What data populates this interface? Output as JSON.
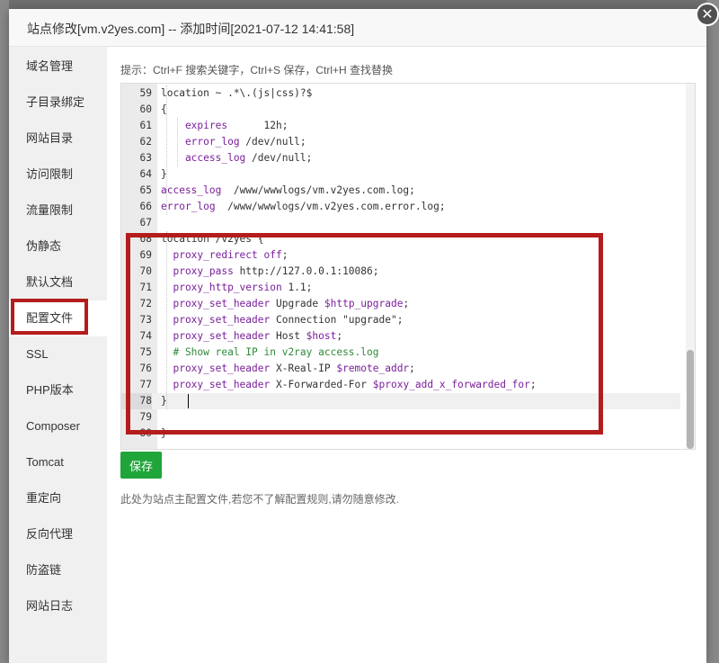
{
  "modal": {
    "title": "站点修改[vm.v2yes.com] -- 添加时间[2021-07-12 14:41:58]",
    "close_glyph": "✕"
  },
  "sidebar": {
    "items": [
      {
        "label": "域名管理"
      },
      {
        "label": "子目录绑定"
      },
      {
        "label": "网站目录"
      },
      {
        "label": "访问限制"
      },
      {
        "label": "流量限制"
      },
      {
        "label": "伪静态"
      },
      {
        "label": "默认文档"
      },
      {
        "label": "配置文件",
        "active": true
      },
      {
        "label": "SSL"
      },
      {
        "label": "PHP版本"
      },
      {
        "label": "Composer"
      },
      {
        "label": "Tomcat"
      },
      {
        "label": "重定向"
      },
      {
        "label": "反向代理"
      },
      {
        "label": "防盗链"
      },
      {
        "label": "网站日志"
      }
    ]
  },
  "editor": {
    "hint": "提示：Ctrl+F 搜索关键字，Ctrl+S 保存，Ctrl+H 查找替换",
    "current_line": 78,
    "lines": [
      {
        "n": "59",
        "segs": [
          [
            "pl",
            "location ~ .*\\.(js|css)?$"
          ]
        ]
      },
      {
        "n": "60",
        "segs": [
          [
            "pl",
            "{"
          ]
        ]
      },
      {
        "n": "61",
        "segs": [
          [
            "kw",
            "    expires"
          ],
          [
            "pl",
            "      12h;"
          ]
        ]
      },
      {
        "n": "62",
        "segs": [
          [
            "kw",
            "    error_log"
          ],
          [
            "pl",
            " /dev/null;"
          ]
        ]
      },
      {
        "n": "63",
        "segs": [
          [
            "kw",
            "    access_log"
          ],
          [
            "pl",
            " /dev/null;"
          ]
        ]
      },
      {
        "n": "64",
        "segs": [
          [
            "pl",
            "}"
          ]
        ]
      },
      {
        "n": "65",
        "segs": [
          [
            "kw",
            "access_log"
          ],
          [
            "pl",
            "  /www/wwwlogs/vm.v2yes.com.log;"
          ]
        ]
      },
      {
        "n": "66",
        "segs": [
          [
            "kw",
            "error_log"
          ],
          [
            "pl",
            "  /www/wwwlogs/vm.v2yes.com.error.log;"
          ]
        ]
      },
      {
        "n": "67",
        "segs": [
          [
            "pl",
            ""
          ]
        ]
      },
      {
        "n": "68",
        "segs": [
          [
            "pl",
            "location /v2yes {"
          ]
        ]
      },
      {
        "n": "69",
        "segs": [
          [
            "kw",
            "  proxy_redirect"
          ],
          [
            "vr",
            " off"
          ],
          [
            "pl",
            ";"
          ]
        ]
      },
      {
        "n": "70",
        "segs": [
          [
            "kw",
            "  proxy_pass"
          ],
          [
            "pl",
            " http://127.0.0.1:10086;"
          ]
        ]
      },
      {
        "n": "71",
        "segs": [
          [
            "kw",
            "  proxy_http_version"
          ],
          [
            "pl",
            " 1.1;"
          ]
        ]
      },
      {
        "n": "72",
        "segs": [
          [
            "kw",
            "  proxy_set_header"
          ],
          [
            "pl",
            " Upgrade "
          ],
          [
            "vr",
            "$http_upgrade"
          ],
          [
            "pl",
            ";"
          ]
        ]
      },
      {
        "n": "73",
        "segs": [
          [
            "kw",
            "  proxy_set_header"
          ],
          [
            "pl",
            " Connection \"upgrade\";"
          ]
        ]
      },
      {
        "n": "74",
        "segs": [
          [
            "kw",
            "  proxy_set_header"
          ],
          [
            "pl",
            " Host "
          ],
          [
            "vr",
            "$host"
          ],
          [
            "pl",
            ";"
          ]
        ]
      },
      {
        "n": "75",
        "segs": [
          [
            "cm",
            "  # Show real IP in v2ray access.log"
          ]
        ]
      },
      {
        "n": "76",
        "segs": [
          [
            "kw",
            "  proxy_set_header"
          ],
          [
            "pl",
            " X-Real-IP "
          ],
          [
            "vr",
            "$remote_addr"
          ],
          [
            "pl",
            ";"
          ]
        ]
      },
      {
        "n": "77",
        "segs": [
          [
            "kw",
            "  proxy_set_header"
          ],
          [
            "pl",
            " X-Forwarded-For "
          ],
          [
            "vr",
            "$proxy_add_x_forwarded_for"
          ],
          [
            "pl",
            ";"
          ]
        ]
      },
      {
        "n": "78",
        "segs": [
          [
            "pl",
            "}"
          ]
        ]
      },
      {
        "n": "79",
        "segs": [
          [
            "pl",
            ""
          ]
        ]
      },
      {
        "n": "80",
        "segs": [
          [
            "pl",
            "}"
          ]
        ]
      }
    ]
  },
  "actions": {
    "save_label": "保存",
    "note": "此处为站点主配置文件,若您不了解配置规则,请勿随意修改."
  },
  "colors": {
    "accent_green": "#20a53a",
    "highlight_red": "#b51c1c"
  }
}
